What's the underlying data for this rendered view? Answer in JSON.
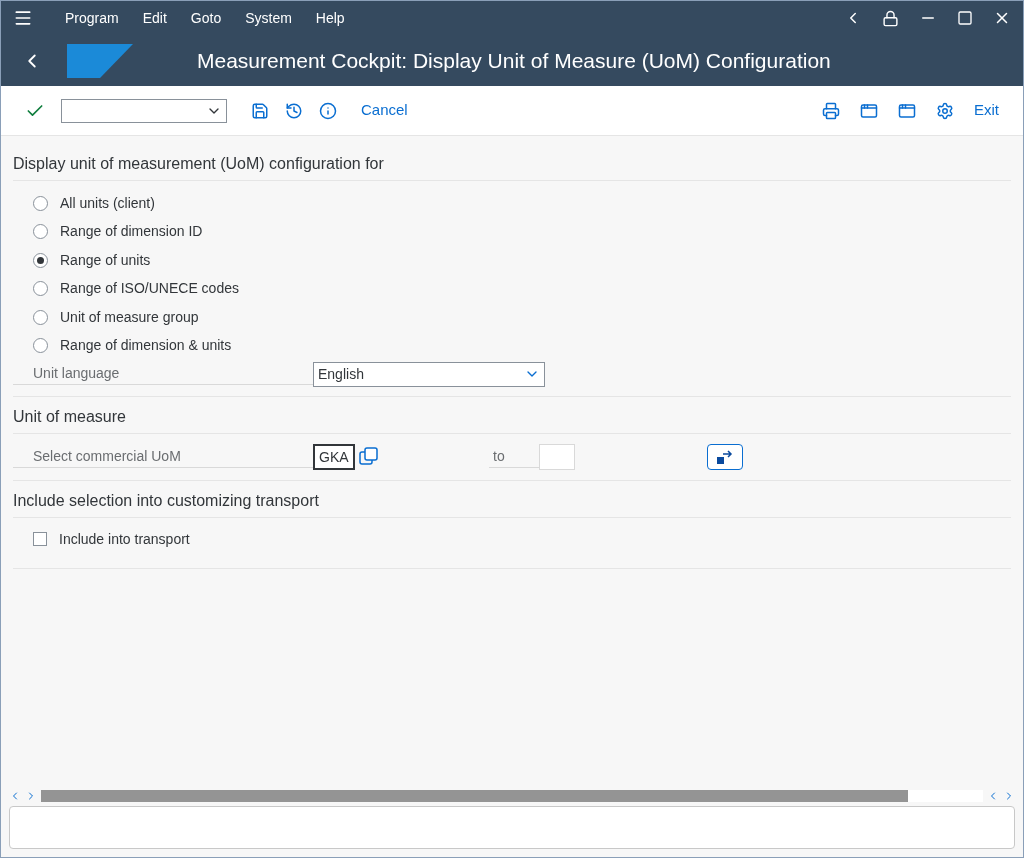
{
  "menu": [
    "Program",
    "Edit",
    "Goto",
    "System",
    "Help"
  ],
  "title": "Measurement Cockpit: Display Unit of Measure (UoM) Configuration",
  "toolbar": {
    "cancel": "Cancel",
    "exit": "Exit"
  },
  "config_section": {
    "heading": "Display unit of measurement (UoM) configuration for",
    "options": [
      {
        "label": "All units (client)",
        "selected": false
      },
      {
        "label": "Range of dimension ID",
        "selected": false
      },
      {
        "label": "Range of units",
        "selected": true
      },
      {
        "label": "Range of ISO/UNECE codes",
        "selected": false
      },
      {
        "label": "Unit of measure group",
        "selected": false
      },
      {
        "label": "Range of dimension & units",
        "selected": false
      }
    ],
    "language": {
      "label": "Unit language",
      "value": "English"
    }
  },
  "uom_section": {
    "heading": "Unit of measure",
    "label": "Select commercial UoM",
    "from": "GKA",
    "to_label": "to"
  },
  "transport_section": {
    "heading": "Include selection into customizing transport",
    "checkbox": {
      "label": "Include into transport",
      "checked": false
    }
  }
}
